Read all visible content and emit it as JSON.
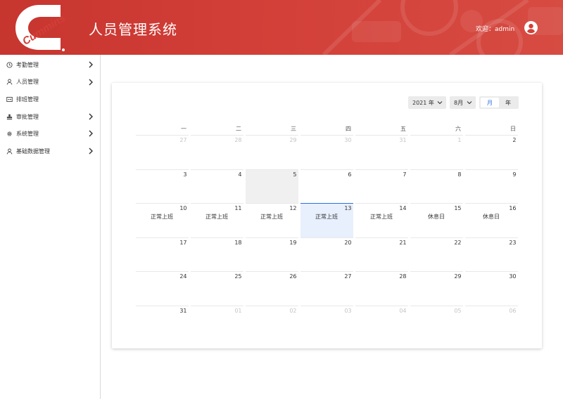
{
  "header": {
    "logo_text": "Cummins",
    "title": "人员管理系统",
    "welcome": "欢迎：admin",
    "avatar_icon": "account-circle-icon",
    "brand_color": "#d23f38"
  },
  "sidebar": {
    "items": [
      {
        "label": "考勤管理",
        "icon": "clock-icon",
        "has_children": true
      },
      {
        "label": "人员管理",
        "icon": "user-icon",
        "has_children": true
      },
      {
        "label": "排班管理",
        "icon": "schedule-icon",
        "has_children": false
      },
      {
        "label": "审批管理",
        "icon": "stamp-icon",
        "has_children": true
      },
      {
        "label": "系统管理",
        "icon": "gear-icon",
        "has_children": true
      },
      {
        "label": "基础数据管理",
        "icon": "user-icon",
        "has_children": true
      }
    ]
  },
  "calendar": {
    "year_select": "2021 年",
    "month_select": "8月",
    "mode_month": "月",
    "mode_year": "年",
    "active_mode": "月",
    "accent_color": "#2f6de1",
    "weekdays": [
      "一",
      "二",
      "三",
      "四",
      "五",
      "六",
      "日"
    ],
    "weeks": [
      [
        {
          "d": "27",
          "other": true
        },
        {
          "d": "28",
          "other": true
        },
        {
          "d": "29",
          "other": true
        },
        {
          "d": "30",
          "other": true
        },
        {
          "d": "31",
          "other": true
        },
        {
          "d": "1",
          "other": true
        },
        {
          "d": "2"
        }
      ],
      [
        {
          "d": "3"
        },
        {
          "d": "4"
        },
        {
          "d": "5",
          "hover": true
        },
        {
          "d": "6"
        },
        {
          "d": "7"
        },
        {
          "d": "8"
        },
        {
          "d": "9"
        }
      ],
      [
        {
          "d": "10",
          "event": "正常上班"
        },
        {
          "d": "11",
          "event": "正常上班"
        },
        {
          "d": "12",
          "event": "正常上班"
        },
        {
          "d": "13",
          "event": "正常上班",
          "selected": true
        },
        {
          "d": "14",
          "event": "正常上班"
        },
        {
          "d": "15",
          "event": "休息日"
        },
        {
          "d": "16",
          "event": "休息日"
        }
      ],
      [
        {
          "d": "17"
        },
        {
          "d": "18"
        },
        {
          "d": "19"
        },
        {
          "d": "20"
        },
        {
          "d": "21"
        },
        {
          "d": "22"
        },
        {
          "d": "23"
        }
      ],
      [
        {
          "d": "24"
        },
        {
          "d": "25"
        },
        {
          "d": "26"
        },
        {
          "d": "27"
        },
        {
          "d": "28"
        },
        {
          "d": "29"
        },
        {
          "d": "30"
        }
      ],
      [
        {
          "d": "31"
        },
        {
          "d": "01",
          "other": true
        },
        {
          "d": "02",
          "other": true
        },
        {
          "d": "03",
          "other": true
        },
        {
          "d": "04",
          "other": true
        },
        {
          "d": "05",
          "other": true
        },
        {
          "d": "06",
          "other": true
        }
      ]
    ]
  }
}
